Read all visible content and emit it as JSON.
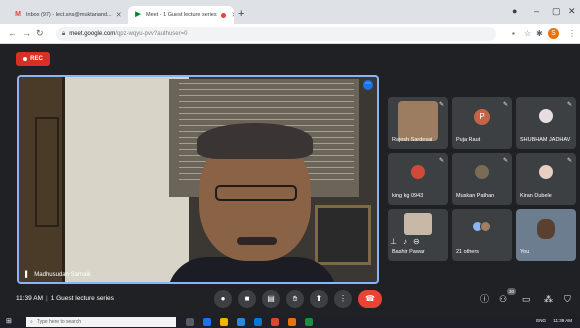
{
  "browser": {
    "tabs": [
      {
        "title": "Inbox (97) - lect.sns@muktanand...",
        "favicon": "gmail-icon",
        "color": "#ea4335"
      },
      {
        "title": "Meet - 1 Guest lecture series",
        "favicon": "meet-icon",
        "color": "#00832d",
        "recording": true
      }
    ],
    "new_tab": "+",
    "address": {
      "host": "meet.google.com",
      "path": "/qpz-wqyu-pvv?authuser=0"
    },
    "profile_initial": "S"
  },
  "meet": {
    "rec_label": "REC",
    "main_speaker": "Madhusudan Sarnaik",
    "tiles": [
      {
        "name": "Rajesh Sardesai",
        "kind": "photo",
        "color": "#b98a62"
      },
      {
        "name": "Puja Raut",
        "kind": "letter",
        "letter": "P",
        "color": "#c26447"
      },
      {
        "name": "SHUBHAM JADHAV",
        "kind": "photo",
        "color": "#e6dde0"
      },
      {
        "name": "king kg 0943",
        "kind": "photo",
        "color": "#d04a3a"
      },
      {
        "name": "Muskan Pathan",
        "kind": "photo",
        "color": "#7a6b55"
      },
      {
        "name": "Kiran Dubele",
        "kind": "photo",
        "color": "#e8cfc2"
      },
      {
        "name": "Bashir Pawar",
        "kind": "hover",
        "color": "#c8b8a8"
      },
      {
        "name": "21 others",
        "kind": "others",
        "color": "#8ab4f8"
      },
      {
        "name": "You",
        "kind": "self",
        "color": "#6b7d8f"
      }
    ],
    "time": "11:39 AM",
    "meeting_title": "1 Guest lecture series",
    "participant_count": "30"
  },
  "taskbar": {
    "search_placeholder": "Type here to search",
    "lang": "ENG",
    "clock": "11:39 AM"
  }
}
